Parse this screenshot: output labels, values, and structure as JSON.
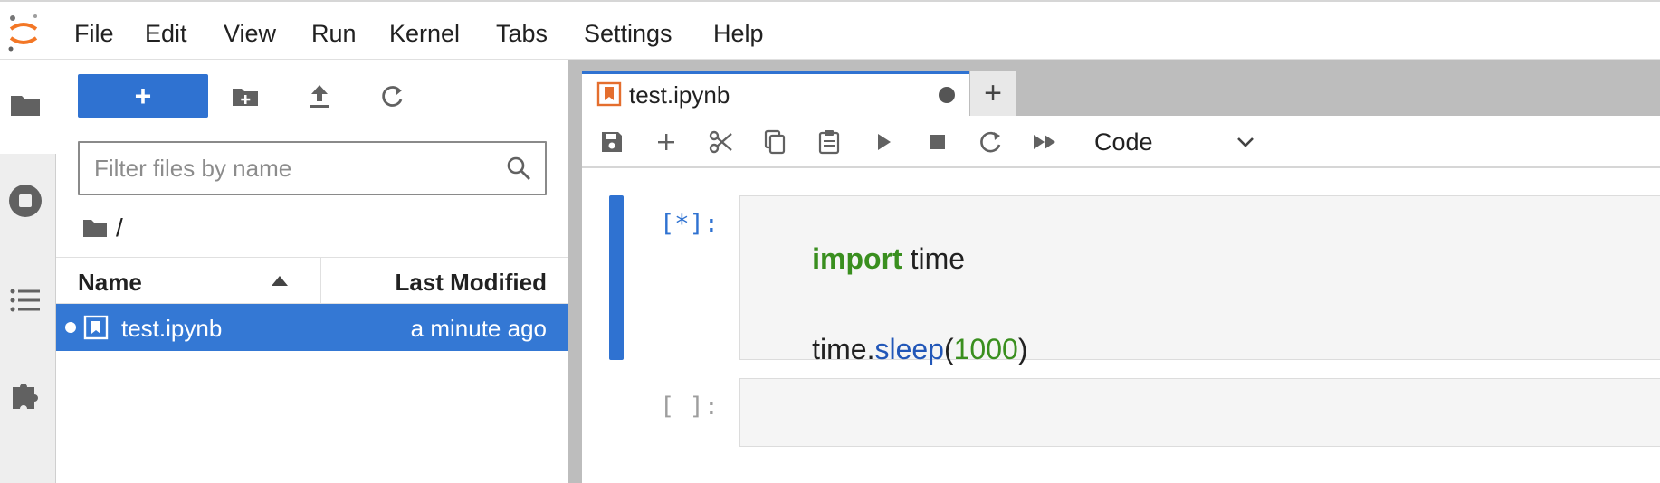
{
  "menubar": {
    "items": [
      "File",
      "Edit",
      "View",
      "Run",
      "Kernel",
      "Tabs",
      "Settings",
      "Help"
    ]
  },
  "activitybar": {
    "icons": [
      "folder-icon",
      "stop-circle-icon",
      "list-icon",
      "puzzle-icon"
    ]
  },
  "filebrowser": {
    "new_button_label": "+",
    "filter_placeholder": "Filter files by name",
    "breadcrumb": "/",
    "columns": {
      "name": "Name",
      "modified": "Last Modified"
    },
    "files": [
      {
        "name": "test.ipynb",
        "modified": "a minute ago",
        "selected": true,
        "running": true
      }
    ]
  },
  "notebook": {
    "tabs": [
      {
        "label": "test.ipynb",
        "dirty": true
      }
    ],
    "add_tab_label": "+",
    "cell_type": "Code",
    "cells": [
      {
        "prompt": "[*]:",
        "lines": [
          [
            {
              "t": "import",
              "c": "kw"
            },
            {
              "t": " time",
              "c": ""
            }
          ],
          [],
          [
            {
              "t": "time.",
              "c": ""
            },
            {
              "t": "sleep",
              "c": "fn"
            },
            {
              "t": "(",
              "c": ""
            },
            {
              "t": "1000",
              "c": "num"
            },
            {
              "t": ")",
              "c": ""
            }
          ]
        ]
      },
      {
        "prompt": "[ ]:",
        "lines": []
      }
    ]
  },
  "colors": {
    "accent": "#2f72d1",
    "selection": "#3478d4",
    "keyword": "#3a8f1f",
    "function": "#2257b8"
  }
}
